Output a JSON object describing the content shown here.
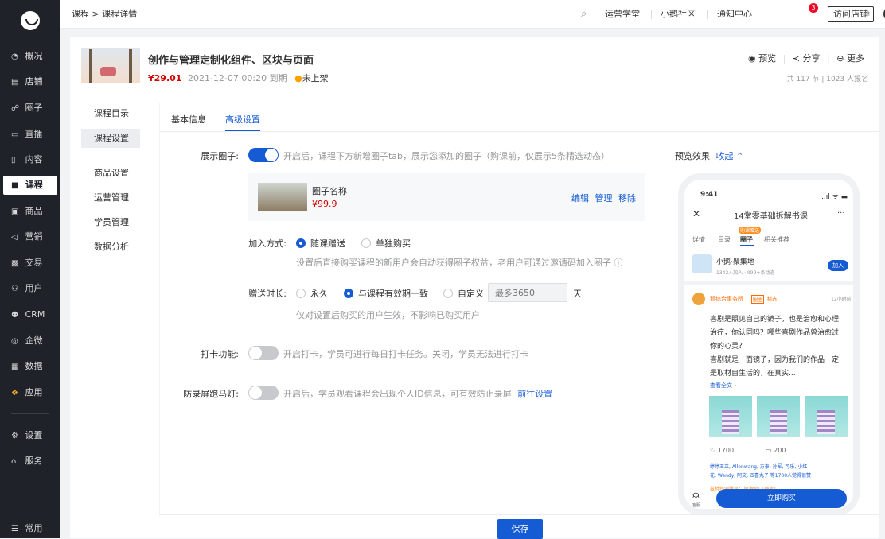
{
  "sidebar": {
    "items": [
      {
        "icon": "◔",
        "label": "概况"
      },
      {
        "icon": "▤",
        "label": "店铺"
      },
      {
        "icon": "☍",
        "label": "圈子"
      },
      {
        "icon": "▭",
        "label": "直播"
      },
      {
        "icon": "▯",
        "label": "内容"
      },
      {
        "icon": "■",
        "label": "课程"
      },
      {
        "icon": "▣",
        "label": "商品"
      },
      {
        "icon": "◁",
        "label": "营销"
      },
      {
        "icon": "▩",
        "label": "交易"
      },
      {
        "icon": "⚇",
        "label": "用户"
      },
      {
        "icon": "⚉",
        "label": "CRM"
      },
      {
        "icon": "◎",
        "label": "企微"
      },
      {
        "icon": "▦",
        "label": "数据"
      },
      {
        "icon": "❖",
        "label": "应用"
      },
      {
        "icon": "⚙",
        "label": "设置"
      },
      {
        "icon": "⌂",
        "label": "服务"
      },
      {
        "icon": "☰",
        "label": "常用"
      }
    ]
  },
  "topbar": {
    "breadcrumb": "课程 > 课程详情",
    "links": [
      "运营学堂",
      "小鹅社区",
      "通知中心"
    ],
    "badge": "3",
    "visit_shop": "访问店铺"
  },
  "product": {
    "title": "创作与管理定制化组件、区块与页面",
    "price": "¥29.01",
    "expiry": "2021-12-07 00:20 到期",
    "status": "未上架",
    "actions": [
      "预览",
      "分享",
      "更多"
    ],
    "stats": "共 117 节 | 1023 人报名"
  },
  "leftmenu": {
    "items": [
      "课程目录",
      "课程设置",
      "商品设置",
      "运营管理",
      "学员管理",
      "数据分析"
    ]
  },
  "tabs": [
    "基本信息",
    "高级设置"
  ],
  "settings": {
    "circle_label": "展示圈子:",
    "circle_hint": "开启后，课程下方新增圈子tab，展示您添加的圈子（购课前，仅展示5条精选动态）",
    "circle_name": "圈子名称",
    "circle_price": "¥99.9",
    "circle_actions": [
      "编辑",
      "管理",
      "移除"
    ],
    "join_label": "加入方式:",
    "join_options": [
      "随课赠送",
      "单独购买"
    ],
    "join_hint": "设置后直接购买课程的新用户会自动获得圈子权益，老用户可通过邀请码加入圈子 ⓘ",
    "duration_label": "赠送时长:",
    "duration_options": [
      "永久",
      "与课程有效期一致",
      "自定义"
    ],
    "duration_placeholder": "最多3650",
    "duration_unit": "天",
    "duration_hint": "仅对设置后购买的用户生效，不影响已购买用户",
    "checkin_label": "打卡功能:",
    "checkin_hint": "开启打卡，学员可进行每日打卡任务。关闭，学员无法进行打卡",
    "antirecord_label": "防录屏跑马灯:",
    "antirecord_hint": "开启后，学员观看课程会出现个人ID信息，可有效防止录屏",
    "antirecord_link": "前往设置"
  },
  "preview": {
    "label": "预览效果",
    "collapse": "收起 ⌃",
    "time": "9:41",
    "signal": "..ıl ᯤ ▬",
    "close": "✕",
    "title": "14堂零基础拆解书课",
    "more": "···",
    "tabs": [
      "详情",
      "目录",
      "圈子",
      "相关推荐"
    ],
    "tab_tag": "购课赠送",
    "circle_name": "小鹅·聚集地",
    "circle_stats": "1342人加入 · 999+条动态",
    "join": "加入",
    "poster": "鹅综合事务所",
    "poster_tags": [
      "圈主",
      "精选"
    ],
    "post_time": "12小时前",
    "post_lines": [
      "喜剧是照见自己的镜子，也是治愈和心理",
      "治疗，你认同吗？哪些喜剧作品曾治愈过",
      "你的心灵？",
      "喜剧就是一面镜子，因为我们的作品一定",
      "是取材自生活的，在真实..."
    ],
    "read_more": "查看全文 ›",
    "likes": "1700",
    "comments": "200",
    "like_line1": "婷婷玉立, Allenwang, 方泰, 孙军, 可乐, 小红",
    "like_line2": "花, Wendy, 阿文, 四喜丸子 等1700人觉得很赞",
    "comment_preview": "兹哲特测量官：加油鸭！[图片]",
    "service": "客服",
    "buy": "立即购买"
  },
  "footer": {
    "save": "保存"
  }
}
